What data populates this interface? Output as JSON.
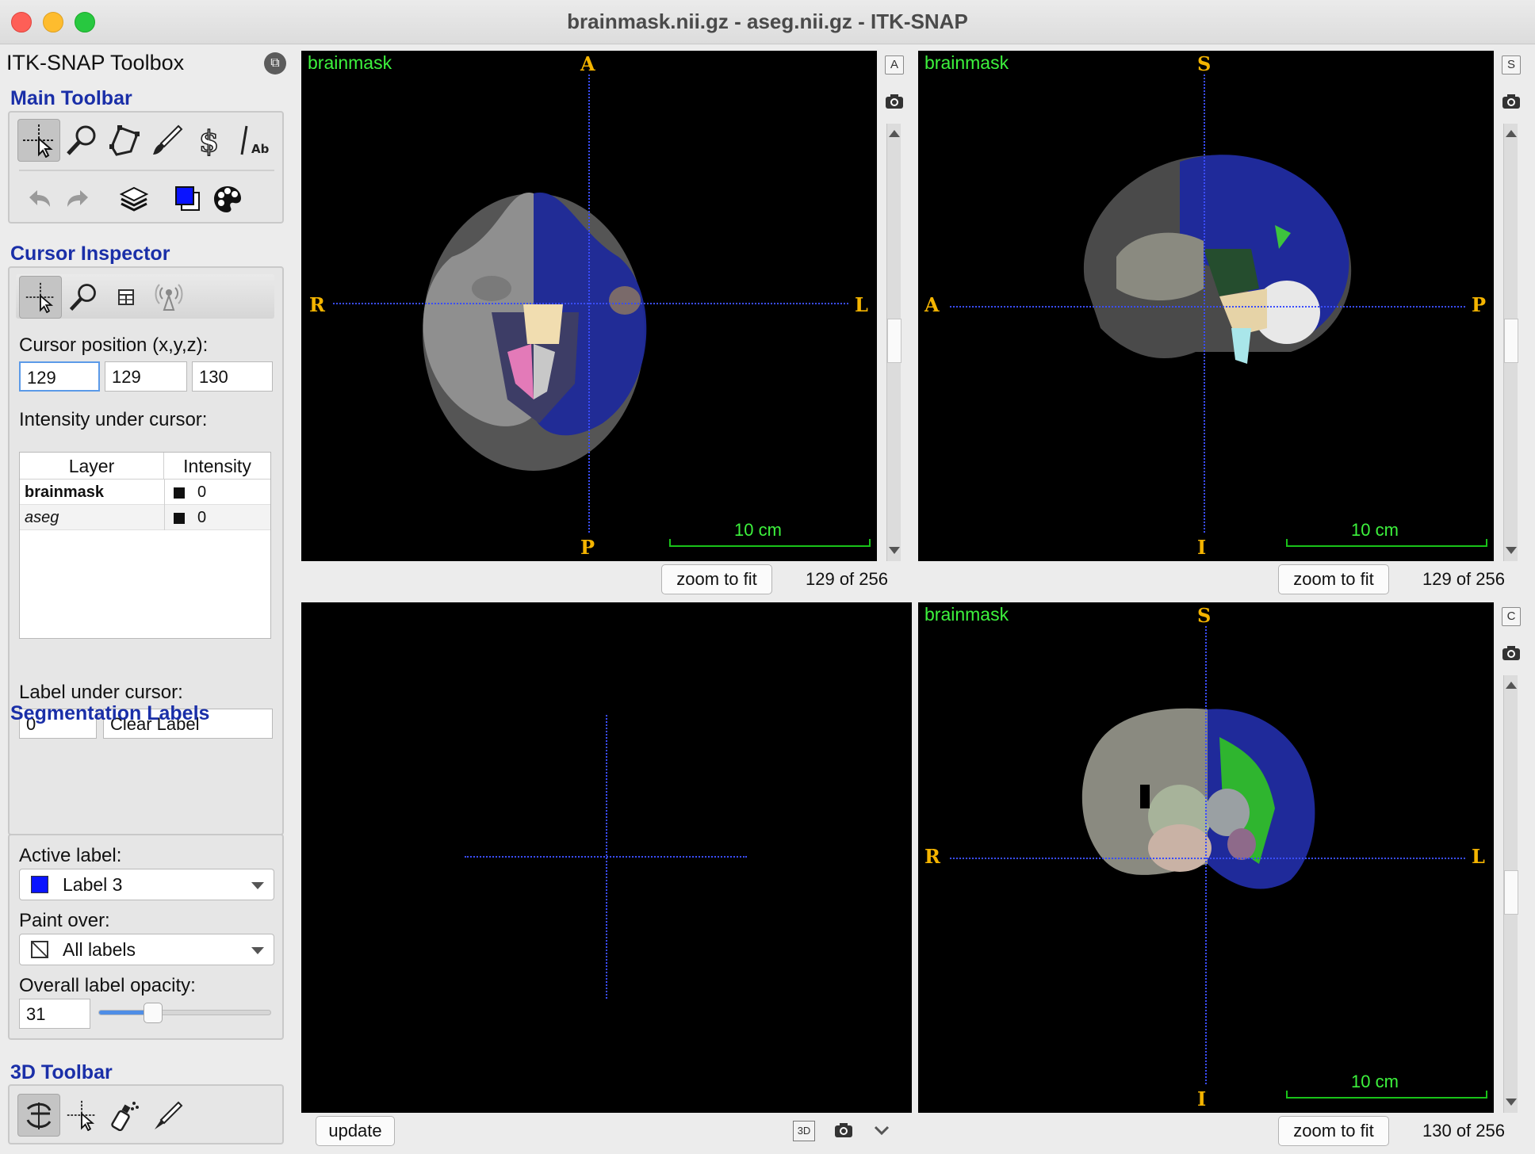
{
  "window": {
    "title": "brainmask.nii.gz - aseg.nii.gz - ITK-SNAP"
  },
  "toolbox": {
    "title": "ITK-SNAP Toolbox",
    "main_toolbar_title": "Main Toolbar",
    "main_tools": [
      "crosshair-tool-icon",
      "zoom-tool-icon",
      "polygon-tool-icon",
      "paintbrush-tool-icon",
      "snake-tool-icon",
      "annotation-tool-icon"
    ],
    "main_tools_row2": [
      "undo-icon",
      "redo-icon",
      "layers-icon",
      "label-color-icon",
      "palette-icon"
    ],
    "cursor_inspector_title": "Cursor Inspector",
    "cursor_position_label": "Cursor position (x,y,z):",
    "cursor_x": "129",
    "cursor_y": "129",
    "cursor_z": "130",
    "intensity_label": "Intensity under cursor:",
    "table_headers": [
      "Layer",
      "Intensity"
    ],
    "table_rows": [
      {
        "layer": "brainmask",
        "intensity": "0"
      },
      {
        "layer": "aseg",
        "intensity": "0"
      }
    ],
    "label_under_cursor_label": "Label under cursor:",
    "label_value": "0",
    "label_name": "Clear Label",
    "segmentation_title": "Segmentation Labels",
    "active_label_caption": "Active label:",
    "active_label": "Label 3",
    "active_label_color": "#0a14ff",
    "paint_over_caption": "Paint over:",
    "paint_over": "All labels",
    "opacity_caption": "Overall label opacity:",
    "opacity_value": "31",
    "opacity_fraction": 0.31,
    "toolbar3d_title": "3D Toolbar"
  },
  "views": {
    "axial": {
      "layer": "brainmask",
      "top": "A",
      "bottom": "P",
      "left": "R",
      "right": "L",
      "scale": "10 cm",
      "zoom_button": "zoom to fit",
      "slice": "129 of 256",
      "mode_letter": "A"
    },
    "sagittal": {
      "layer": "brainmask",
      "top": "S",
      "bottom": "I",
      "left": "A",
      "right": "P",
      "scale": "10 cm",
      "zoom_button": "zoom to fit",
      "slice": "129 of 256",
      "mode_letter": "S"
    },
    "coronal": {
      "layer": "brainmask",
      "top": "S",
      "bottom": "I",
      "left": "R",
      "right": "L",
      "scale": "10 cm",
      "zoom_button": "zoom to fit",
      "slice": "130 of 256",
      "mode_letter": "C"
    },
    "three_d": {
      "update_button": "update",
      "mode_label": "3D"
    }
  },
  "colors": {
    "crosshair": "#3a4dff",
    "orientation": "#f4b400",
    "overlay_text": "#3df23d",
    "section_title": "#1a2fa8"
  }
}
